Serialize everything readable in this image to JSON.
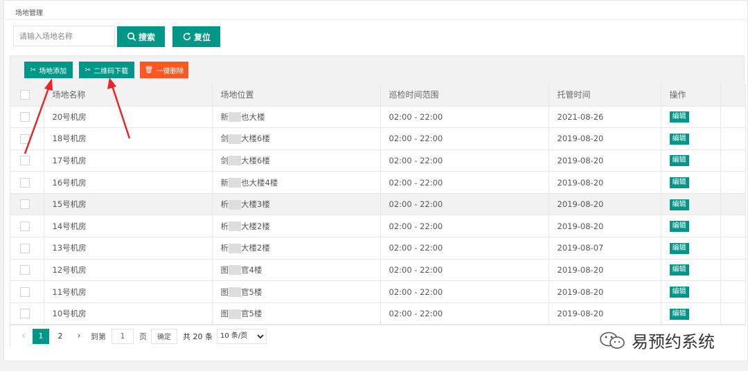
{
  "breadcrumb": "场地管理",
  "search": {
    "placeholder": "请输入场地名称",
    "value": ""
  },
  "actions": {
    "search_label": "搜索",
    "reset_label": "复位"
  },
  "toolbar": {
    "add_label": "场地添加",
    "qrcode_label": "二维码下载",
    "delete_label": "一键删除"
  },
  "table": {
    "headers": [
      "场地名称",
      "场地位置",
      "巡检时间范围",
      "托管时间",
      "操作"
    ],
    "edit_label": "编辑",
    "rows": [
      {
        "name": "20号机房",
        "loc_a": "新",
        "loc_b": "也大楼",
        "time": "02:00 - 22:00",
        "date": "2021-08-26"
      },
      {
        "name": "18号机房",
        "loc_a": "剑",
        "loc_b": "大楼6楼",
        "time": "02:00 - 22:00",
        "date": "2019-08-20"
      },
      {
        "name": "17号机房",
        "loc_a": "剑",
        "loc_b": "大楼6楼",
        "time": "02:00 - 22:00",
        "date": "2019-08-20"
      },
      {
        "name": "16号机房",
        "loc_a": "新",
        "loc_b": "也大楼4楼",
        "time": "02:00 - 22:00",
        "date": "2019-08-20"
      },
      {
        "name": "15号机房",
        "loc_a": "析",
        "loc_b": "大楼3楼",
        "time": "02:00 - 22:00",
        "date": "2019-08-20"
      },
      {
        "name": "14号机房",
        "loc_a": "析",
        "loc_b": "大楼2楼",
        "time": "02:00 - 22:00",
        "date": "2019-08-20"
      },
      {
        "name": "13号机房",
        "loc_a": "析",
        "loc_b": "大楼2楼",
        "time": "02:00 - 22:00",
        "date": "2019-08-07"
      },
      {
        "name": "12号机房",
        "loc_a": "图",
        "loc_b": "官4楼",
        "time": "02:00 - 22:00",
        "date": "2019-08-20"
      },
      {
        "name": "11号机房",
        "loc_a": "图",
        "loc_b": "官5楼",
        "time": "02:00 - 22:00",
        "date": "2019-08-20"
      },
      {
        "name": "10号机房",
        "loc_a": "图",
        "loc_b": "官5楼",
        "time": "02:00 - 22:00",
        "date": "2019-08-20"
      }
    ]
  },
  "pagination": {
    "pages": [
      "1",
      "2"
    ],
    "goto_label": "到第",
    "goto_value": "1",
    "page_unit": "页",
    "confirm_label": "确定",
    "total_label": "共 20 条",
    "page_size": "10 条/页"
  },
  "watermark": "易预约系统",
  "colors": {
    "primary": "#009688",
    "danger": "#ff5722",
    "arrow": "#e8262a"
  }
}
